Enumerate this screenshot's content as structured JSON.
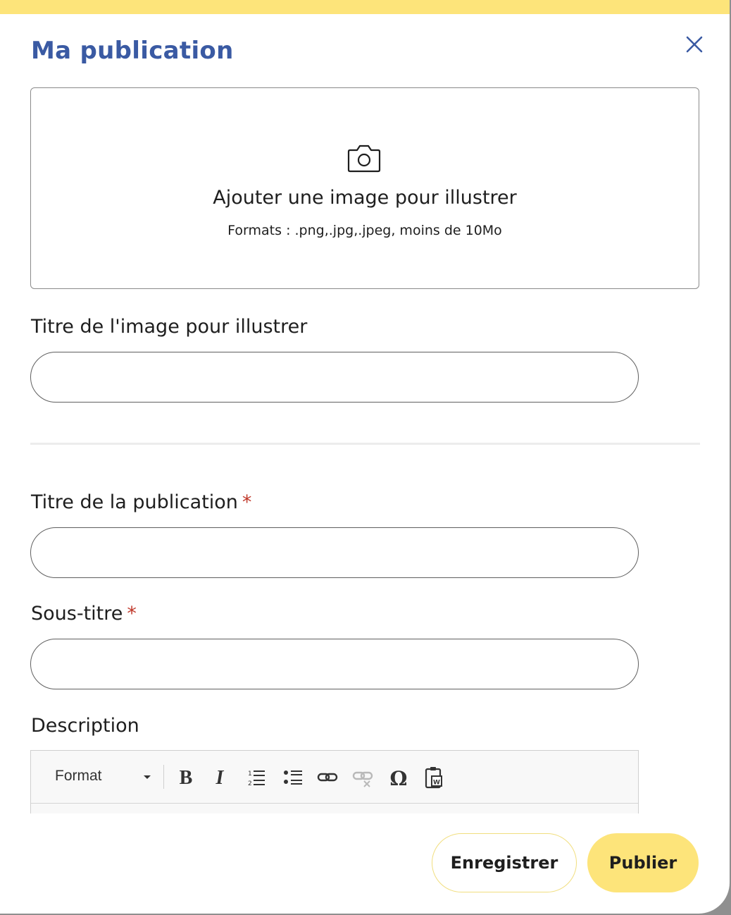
{
  "modal": {
    "title": "Ma publication",
    "close_icon": "close-icon"
  },
  "upload": {
    "icon": "camera-icon",
    "main_text": "Ajouter une image pour illustrer",
    "formats_text": "Formats : .png,.jpg,.jpeg, moins de 10Mo"
  },
  "fields": {
    "image_title": {
      "label": "Titre de l'image pour illustrer",
      "value": ""
    },
    "publication_title": {
      "label": "Titre de la publication",
      "required_mark": "*",
      "value": ""
    },
    "subtitle": {
      "label": "Sous-titre",
      "required_mark": "*",
      "value": ""
    },
    "description": {
      "label": "Description"
    }
  },
  "editor_toolbar": {
    "format_label": "Format",
    "buttons": [
      "bold-icon",
      "italic-icon",
      "numbered-list-icon",
      "bulleted-list-icon",
      "link-icon",
      "unlink-icon",
      "special-character-icon",
      "paste-from-word-icon"
    ]
  },
  "actions": {
    "save_label": "Enregistrer",
    "publish_label": "Publier"
  },
  "colors": {
    "accent_yellow": "#fde47a",
    "title_blue": "#3a5aa3",
    "required_red": "#c0392b"
  }
}
